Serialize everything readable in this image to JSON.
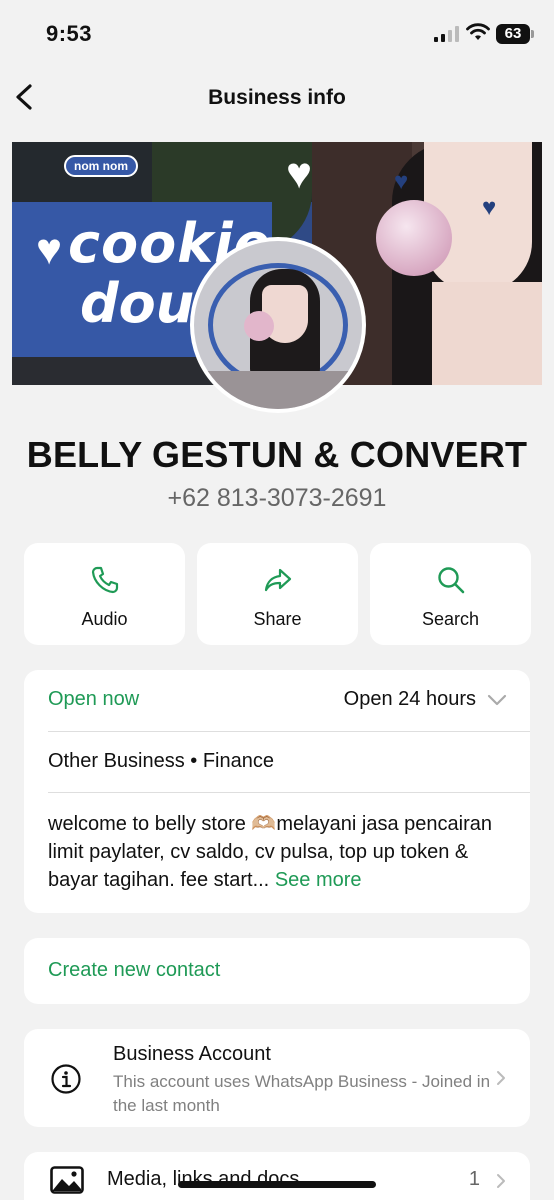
{
  "status_bar": {
    "time": "9:53",
    "battery": "63",
    "icons": [
      "cellular-signal-icon",
      "wifi-icon",
      "battery-icon"
    ]
  },
  "nav": {
    "title": "Business info",
    "back_icon": "chevron-left-icon"
  },
  "cover": {
    "stickers": [
      "nom nom",
      "cookie",
      "dough"
    ]
  },
  "profile": {
    "name": "BELLY GESTUN & CONVERT",
    "phone": "+62 813-3073-2691"
  },
  "actions": [
    {
      "label": "Audio",
      "icon": "phone-icon"
    },
    {
      "label": "Share",
      "icon": "share-arrow-icon"
    },
    {
      "label": "Search",
      "icon": "search-icon"
    }
  ],
  "hours": {
    "status": "Open now",
    "detail": "Open 24 hours"
  },
  "category": "Other Business • Finance",
  "description": {
    "text": "welcome to belly store 🫶🏼melayani jasa pencairan limit paylater, cv saldo, cv pulsa, top up token & bayar tagihan. fee start...",
    "see_more": "See more"
  },
  "contact": {
    "create_label": "Create new contact"
  },
  "account": {
    "title": "Business Account",
    "subtitle": "This account uses WhatsApp Business - Joined in the last month"
  },
  "media": {
    "label": "Media, links and docs",
    "count": "1"
  },
  "colors": {
    "accent": "#1f9a56",
    "background": "#f2f2f2",
    "card": "#ffffff"
  }
}
